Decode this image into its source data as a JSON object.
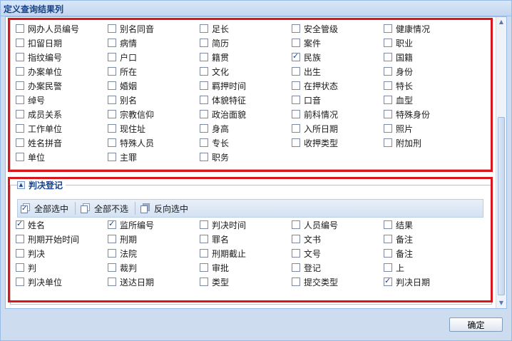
{
  "window": {
    "title": "定义查询结果列"
  },
  "section1": {
    "items": [
      {
        "label": "网办人员编号",
        "checked": false
      },
      {
        "label": "别名同音",
        "checked": false
      },
      {
        "label": "足长",
        "checked": false
      },
      {
        "label": "安全管级",
        "checked": false
      },
      {
        "label": "健康情况",
        "checked": false
      },
      {
        "label": "扣留日期",
        "checked": false
      },
      {
        "label": "病情",
        "checked": false
      },
      {
        "label": "简历",
        "checked": false
      },
      {
        "label": "案件",
        "checked": false
      },
      {
        "label": "职业",
        "checked": false
      },
      {
        "label": "指纹编号",
        "checked": false
      },
      {
        "label": "户口",
        "checked": false
      },
      {
        "label": "籍贯",
        "checked": false
      },
      {
        "label": "民族",
        "checked": true
      },
      {
        "label": "国籍",
        "checked": false
      },
      {
        "label": "办案单位",
        "checked": false
      },
      {
        "label": "所在",
        "checked": false
      },
      {
        "label": "文化",
        "checked": false
      },
      {
        "label": "出生",
        "checked": false
      },
      {
        "label": "身份",
        "checked": false
      },
      {
        "label": "办案民警",
        "checked": false
      },
      {
        "label": "婚姻",
        "checked": false
      },
      {
        "label": "羁押时间",
        "checked": false
      },
      {
        "label": "在押状态",
        "checked": false
      },
      {
        "label": "特长",
        "checked": false
      },
      {
        "label": "绰号",
        "checked": false
      },
      {
        "label": "别名",
        "checked": false
      },
      {
        "label": "体貌特征",
        "checked": false
      },
      {
        "label": "口音",
        "checked": false
      },
      {
        "label": "血型",
        "checked": false
      },
      {
        "label": "成员关系",
        "checked": false
      },
      {
        "label": "宗教信仰",
        "checked": false
      },
      {
        "label": "政治面貌",
        "checked": false
      },
      {
        "label": "前科情况",
        "checked": false
      },
      {
        "label": "特殊身份",
        "checked": false
      },
      {
        "label": "工作单位",
        "checked": false
      },
      {
        "label": "现住址",
        "checked": false
      },
      {
        "label": "身高",
        "checked": false
      },
      {
        "label": "入所日期",
        "checked": false
      },
      {
        "label": "照片",
        "checked": false
      },
      {
        "label": "姓名拼音",
        "checked": false
      },
      {
        "label": "特殊人员",
        "checked": false
      },
      {
        "label": "专长",
        "checked": false
      },
      {
        "label": "收押类型",
        "checked": false
      },
      {
        "label": "附加刑",
        "checked": false
      },
      {
        "label": "单位",
        "checked": false
      },
      {
        "label": "主罪",
        "checked": false
      },
      {
        "label": "职务",
        "checked": false
      }
    ]
  },
  "section2": {
    "legend": "判决登记",
    "toolbar": {
      "select_all": "全部选中",
      "select_none": "全部不选",
      "invert": "反向选中"
    },
    "items": [
      {
        "label": "姓名",
        "checked": true
      },
      {
        "label": "监所编号",
        "checked": true
      },
      {
        "label": "判决时间",
        "checked": false
      },
      {
        "label": "人员编号",
        "checked": false
      },
      {
        "label": "结果",
        "checked": false
      },
      {
        "label": "刑期开始时间",
        "checked": false
      },
      {
        "label": "刑期",
        "checked": false
      },
      {
        "label": "罪名",
        "checked": false
      },
      {
        "label": "文书",
        "checked": false
      },
      {
        "label": "备注",
        "checked": false
      },
      {
        "label": "判决",
        "checked": false
      },
      {
        "label": "法院",
        "checked": false
      },
      {
        "label": "刑期截止",
        "checked": false
      },
      {
        "label": "文号",
        "checked": false
      },
      {
        "label": "备注",
        "checked": false
      },
      {
        "label": "判",
        "checked": false
      },
      {
        "label": "裁判",
        "checked": false
      },
      {
        "label": "审批",
        "checked": false
      },
      {
        "label": "登记",
        "checked": false
      },
      {
        "label": "上",
        "checked": false
      },
      {
        "label": "判决单位",
        "checked": false
      },
      {
        "label": "送达日期",
        "checked": false
      },
      {
        "label": "类型",
        "checked": false
      },
      {
        "label": "提交类型",
        "checked": false
      },
      {
        "label": "判决日期",
        "checked": true
      }
    ]
  },
  "footer": {
    "ok_label": "确定"
  }
}
